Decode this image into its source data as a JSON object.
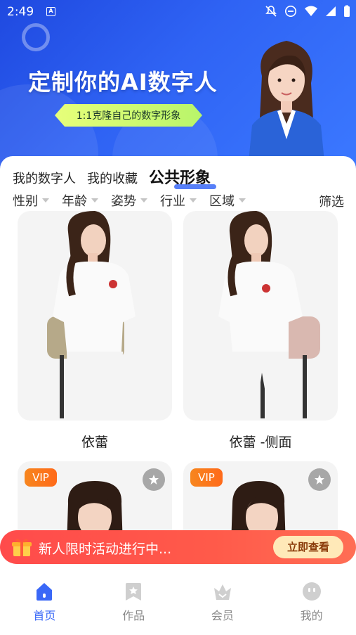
{
  "status_bar": {
    "time": "2:49",
    "app_badge": "A"
  },
  "banner": {
    "title": "定制你的AI数字人",
    "pill": "1:1克隆自己的数字形象"
  },
  "tabs": [
    {
      "label": "我的数字人"
    },
    {
      "label": "我的收藏"
    },
    {
      "label": "公共形象",
      "active": true
    }
  ],
  "filters": {
    "items": [
      {
        "label": "性别"
      },
      {
        "label": "年龄"
      },
      {
        "label": "姿势"
      },
      {
        "label": "行业"
      },
      {
        "label": "区域"
      }
    ],
    "right_label": "筛选"
  },
  "cards": [
    {
      "name": "依蕾"
    },
    {
      "name": "依蕾 -侧面"
    },
    {
      "badge": "VIP"
    },
    {
      "badge": "VIP"
    }
  ],
  "promo": {
    "text": "新人限时活动进行中...",
    "button": "立即查看"
  },
  "bottom_nav": [
    {
      "label": "首页",
      "icon": "home-icon",
      "active": true
    },
    {
      "label": "作品",
      "icon": "works-icon"
    },
    {
      "label": "会员",
      "icon": "vip-crown-icon"
    },
    {
      "label": "我的",
      "icon": "profile-icon"
    }
  ],
  "colors": {
    "primary": "#3a68f7",
    "banner": "#2f63f4",
    "promo": "#ff4b4b",
    "vip": "#f7861e"
  }
}
